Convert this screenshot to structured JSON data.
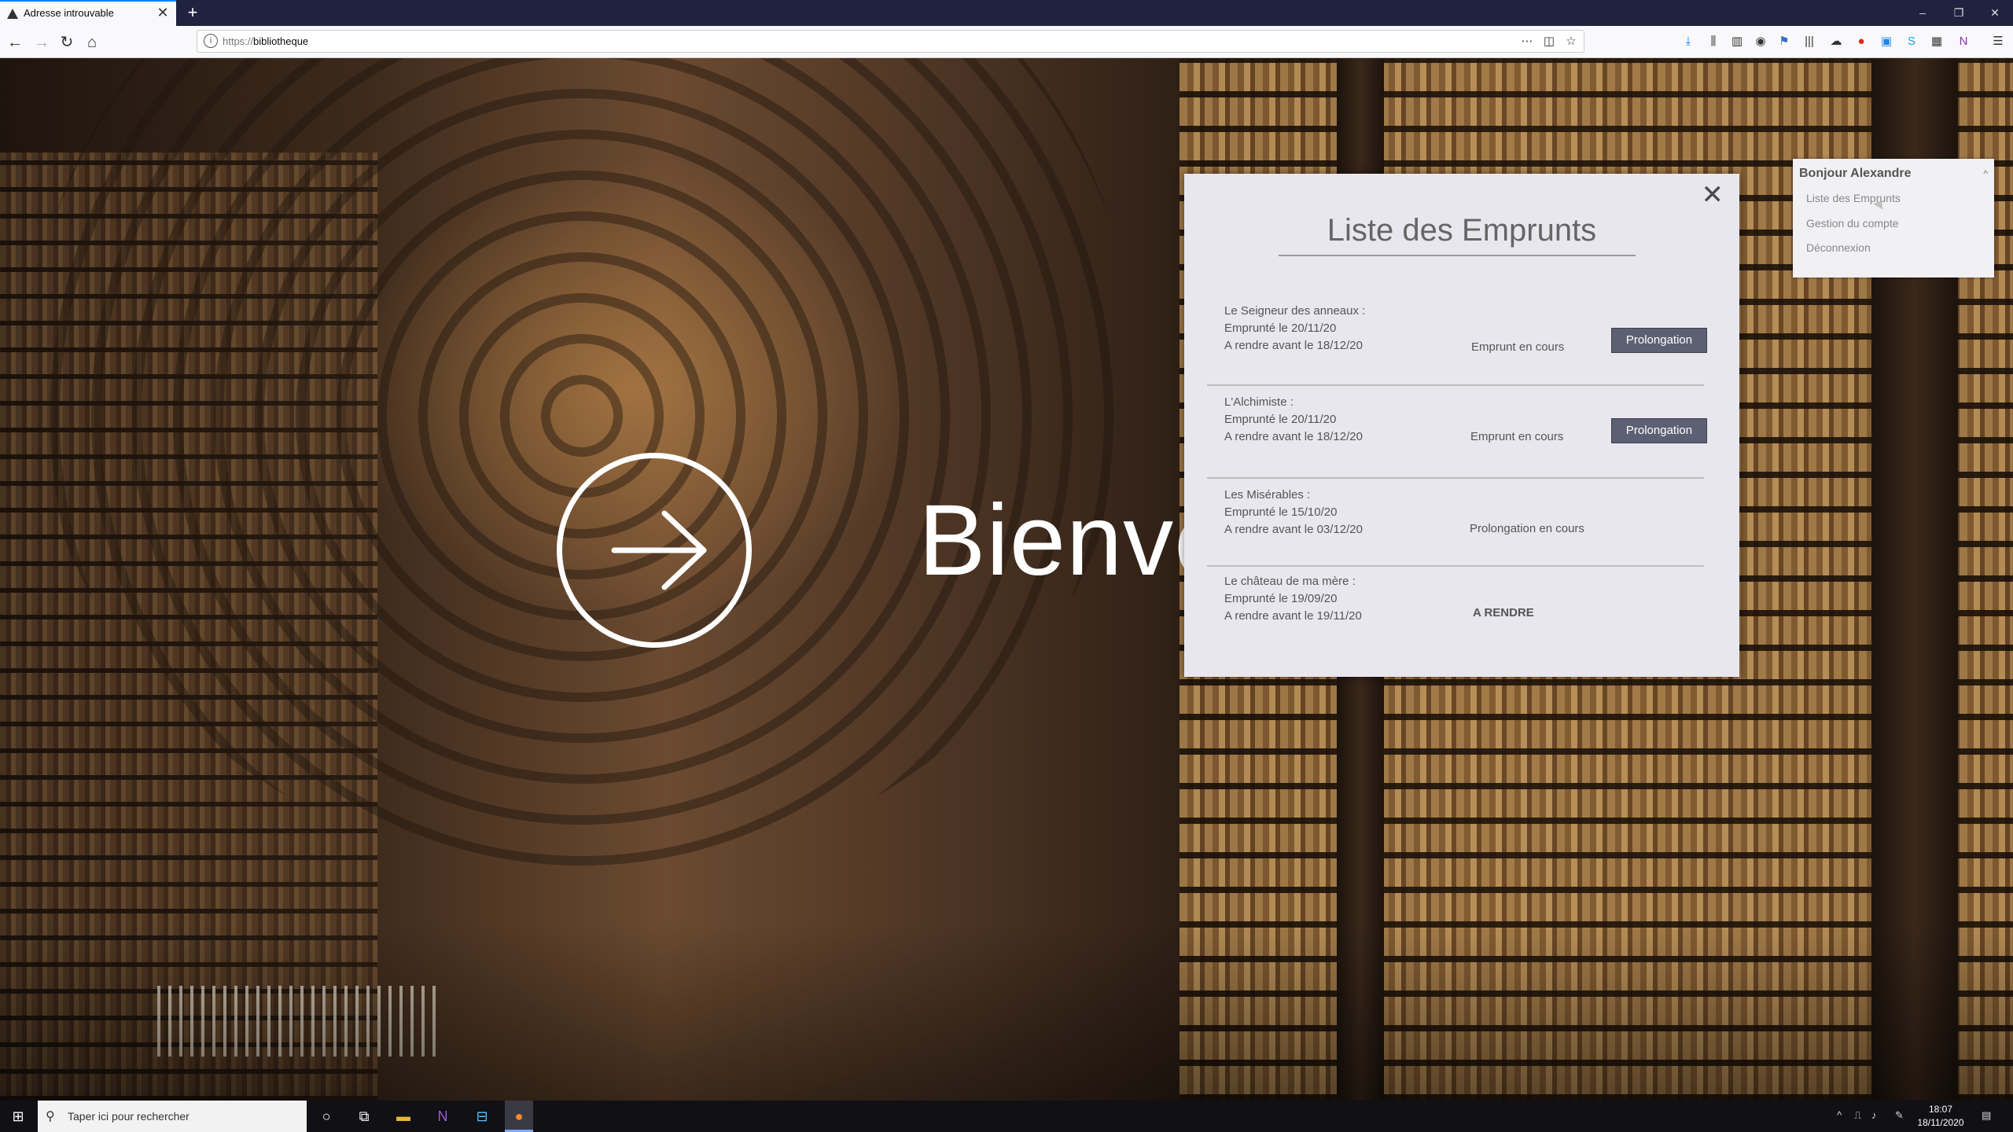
{
  "browser": {
    "tab_title": "Adresse introuvable",
    "tab_close": "✕",
    "new_tab": "+",
    "url_protocol": "https://",
    "url_host": "bibliotheque",
    "window_buttons": [
      "–",
      "❐",
      "✕"
    ]
  },
  "hero": {
    "text": "Bienvenue"
  },
  "modal": {
    "title": "Liste des Emprunts",
    "close": "✕",
    "loans": [
      {
        "title": "Le Seigneur des anneaux :",
        "borrowed": "Emprunté le 20/11/20",
        "due": "A rendre avant le 18/12/20",
        "status": "Emprunt en cours",
        "action": "Prolongation"
      },
      {
        "title": "L'Alchimiste :",
        "borrowed": "Emprunté le 20/11/20",
        "due": "A rendre avant le 18/12/20",
        "status": "Emprunt en cours",
        "action": "Prolongation"
      },
      {
        "title": "Les Misérables :",
        "borrowed": "Emprunté le 15/10/20",
        "due": "A rendre avant le 03/12/20",
        "status": "Prolongation en cours",
        "action": ""
      },
      {
        "title": "Le château de ma mère :",
        "borrowed": "Emprunté le 19/09/20",
        "due": "A rendre avant le 19/11/20",
        "status": "A RENDRE",
        "action": ""
      }
    ]
  },
  "user_menu": {
    "greeting": "Bonjour Alexandre",
    "items": [
      "Liste des Emprunts",
      "Gestion du compte",
      "Déconnexion"
    ]
  },
  "taskbar": {
    "search_placeholder": "Taper ici pour rechercher",
    "time": "18:07",
    "date": "18/11/2020"
  }
}
